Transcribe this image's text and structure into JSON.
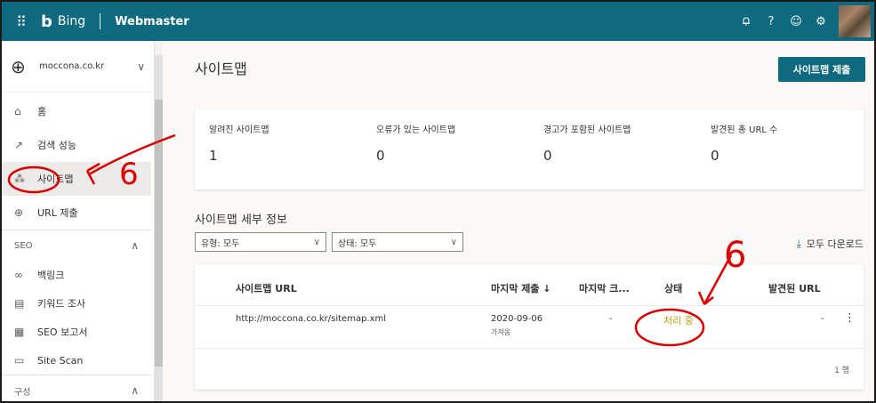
{
  "topbar": {
    "waffle_icon": "waffle-icon",
    "brand": "Bing",
    "product": "Webmaster",
    "icons": [
      "bell-icon",
      "help-icon",
      "smiley-icon",
      "gear-icon"
    ],
    "bg_color": "#0f6a7f"
  },
  "sidebar": {
    "site": "moccona.co.kr",
    "items": [
      {
        "icon": "home-icon",
        "glyph": "⌂",
        "label": "홈"
      },
      {
        "icon": "trend-icon",
        "glyph": "↗",
        "label": "검색 성능"
      },
      {
        "icon": "sitemap-icon",
        "glyph": "⁂",
        "label": "사이트맵"
      },
      {
        "icon": "globe-icon",
        "glyph": "⊕",
        "label": "URL 제출"
      }
    ],
    "seo_section": "SEO",
    "seo_items": [
      {
        "icon": "link-icon",
        "glyph": "∞",
        "label": "백링크"
      },
      {
        "icon": "keyword-icon",
        "glyph": "▤",
        "label": "키워드 조사"
      },
      {
        "icon": "report-icon",
        "glyph": "▦",
        "label": "SEO 보고서"
      },
      {
        "icon": "scan-icon",
        "glyph": "▭",
        "label": "Site Scan"
      }
    ],
    "config_section": "구성"
  },
  "main": {
    "title": "사이트맵",
    "submit_button": "사이트맵 제출",
    "stats": [
      {
        "label": "알려진 사이트맵",
        "value": "1"
      },
      {
        "label": "오류가 있는 사이트맵",
        "value": "0"
      },
      {
        "label": "경고가 포함된 사이트맵",
        "value": "0"
      },
      {
        "label": "발견된 총 URL 수",
        "value": "0"
      }
    ],
    "detail_title": "사이트맵 세부 정보",
    "filter_type": "유형: 모두",
    "filter_status": "상태: 모두",
    "download_all": "모두 다운로드",
    "table": {
      "headers": {
        "url": "사이트맵 URL",
        "last_submit": "마지막 제출 ↓",
        "last_crawl": "마지막 크...",
        "status": "상태",
        "found": "발견된 URL"
      },
      "rows": [
        {
          "url": "http://moccona.co.kr/sitemap.xml",
          "date": "2020-09-06",
          "sub": "가져옴",
          "crawl": "-",
          "status": "처리 중",
          "found": "-"
        }
      ],
      "row_count": "1 행"
    }
  },
  "annotations": {
    "marks": [
      "6",
      "6"
    ],
    "color": "#e00000"
  }
}
